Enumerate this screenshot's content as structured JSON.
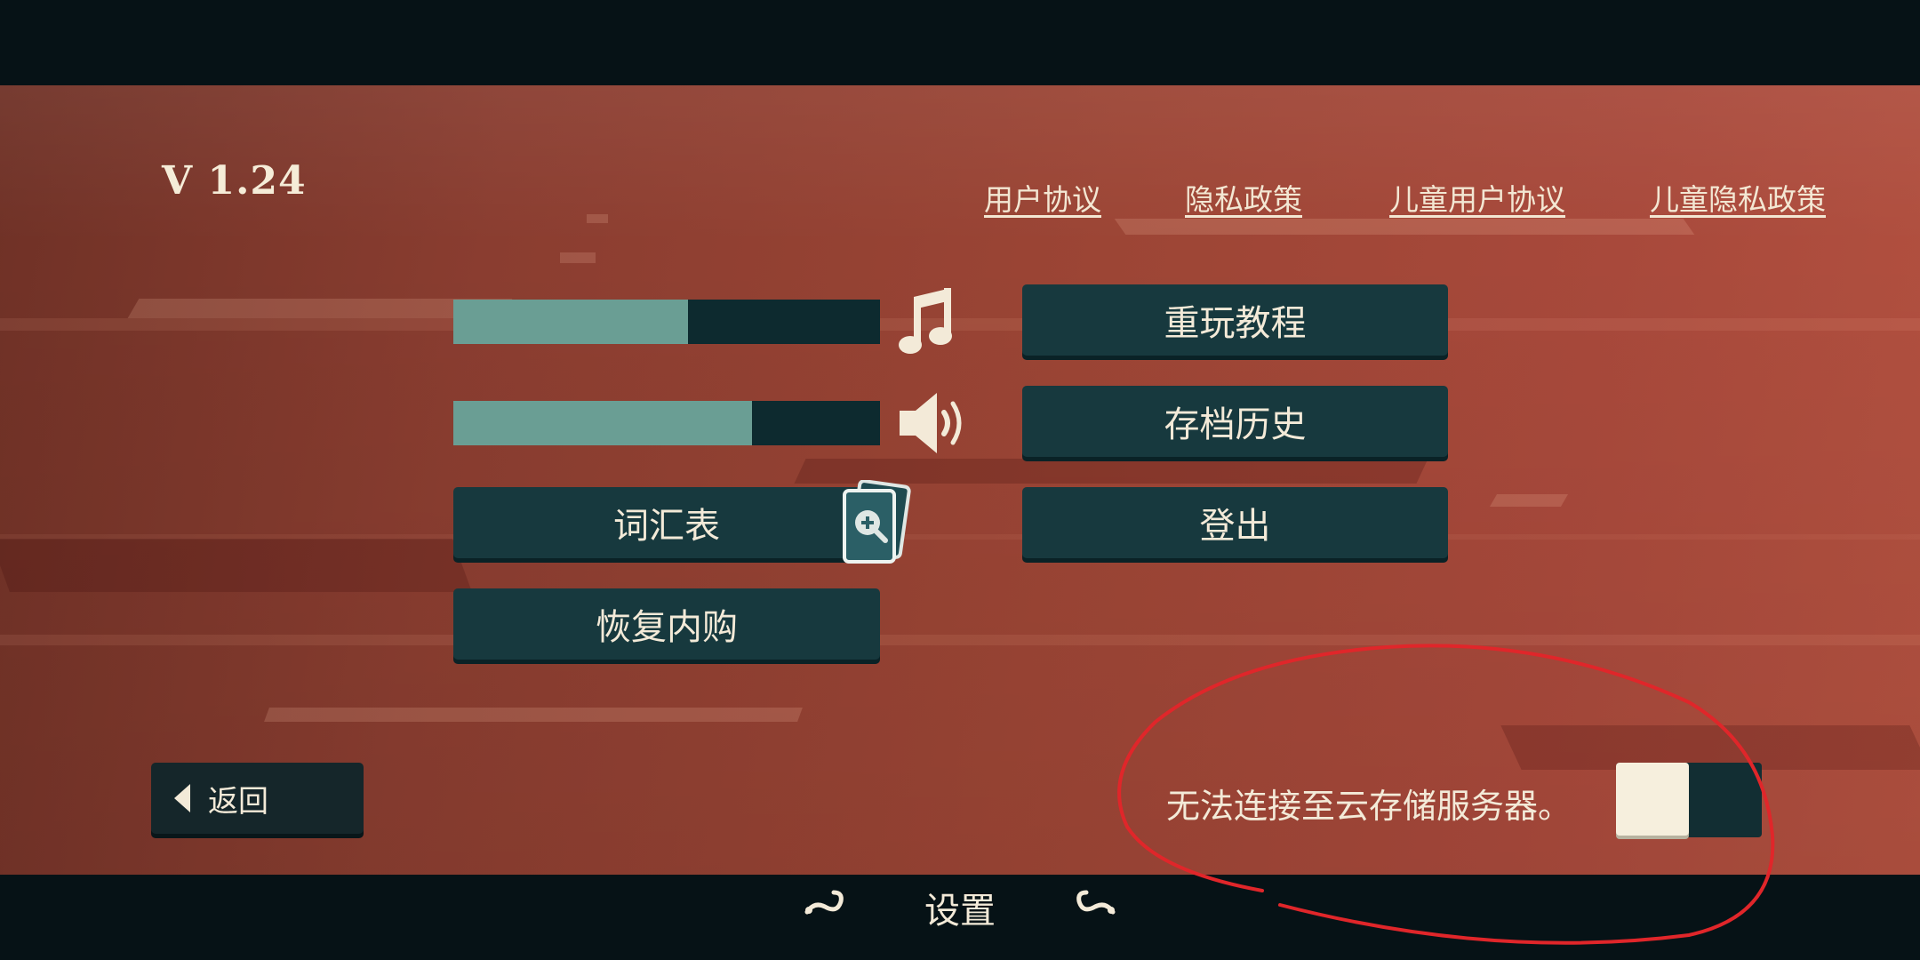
{
  "version": "V 1.24",
  "policies": [
    {
      "label": "用户协议"
    },
    {
      "label": "隐私政策"
    },
    {
      "label": "儿童用户协议"
    },
    {
      "label": "儿童隐私政策"
    }
  ],
  "audio": {
    "music_level": 0.55,
    "sound_level": 0.7,
    "music_icon": "music-note-icon",
    "sound_icon": "speaker-icon"
  },
  "buttons": {
    "replay_tutorial": "重玩教程",
    "save_history": "存档历史",
    "glossary": "词汇表",
    "logout": "登出",
    "restore_purchases": "恢复内购"
  },
  "back": {
    "label": "返回"
  },
  "cloud": {
    "status": "无法连接至云存储服务器。",
    "toggle_on": false
  },
  "title": "设置",
  "colors": {
    "button_bg": "#17393e",
    "slider_fill": "#6a9e94",
    "text": "#f3ead8",
    "annotation": "#e0262a"
  }
}
